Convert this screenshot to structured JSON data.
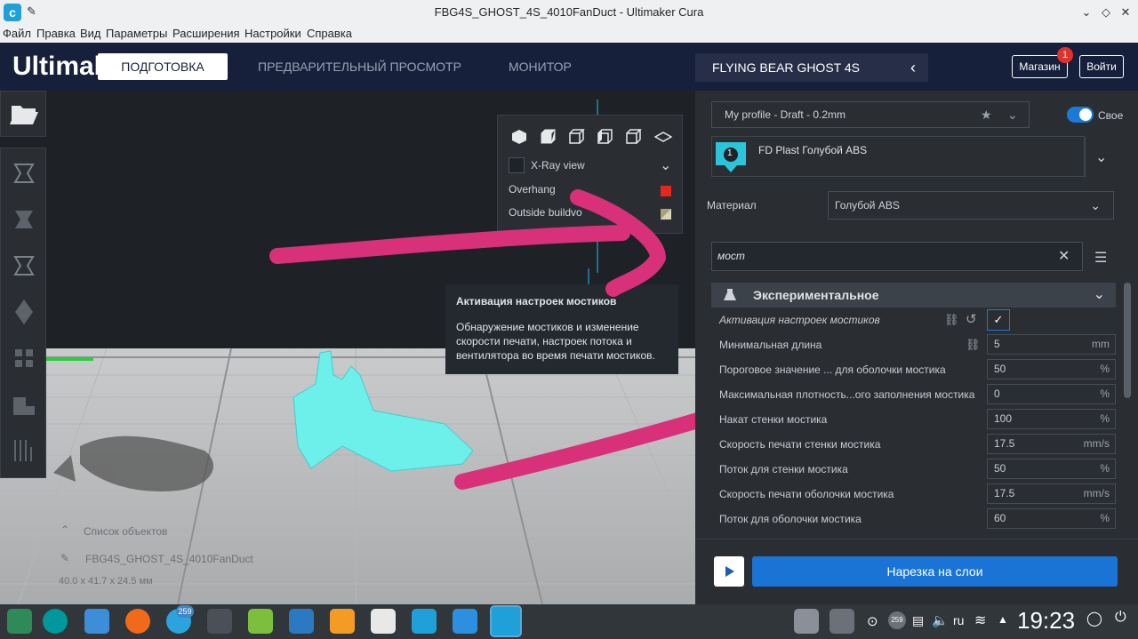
{
  "window": {
    "title": "FBG4S_GHOST_4S_4010FanDuct - Ultimaker Cura"
  },
  "menu": [
    "Файл",
    "Правка",
    "Вид",
    "Параметры",
    "Расширения",
    "Настройки",
    "Справка"
  ],
  "header": {
    "logo": "Ultimal",
    "tabs": [
      "ПОДГОТОВКА",
      "ПРЕДВАРИТЕЛЬНЫЙ ПРОСМОТР",
      "МОНИТОР"
    ],
    "printer": "FLYING BEAR GHOST 4S",
    "store_label": "Магазин",
    "store_badge": "1",
    "login_label": "Войти"
  },
  "view_panel": {
    "xray_label": "X-Ray view",
    "overhang_label": "Overhang",
    "outside_label": "Outside buildvo",
    "overhang_color": "#e8261e"
  },
  "tooltip": {
    "title": "Активация настроек мостиков",
    "body": "Обнаружение мостиков и изменение скорости печати, настроек потока и вентилятора во время печати мостиков."
  },
  "objects": {
    "list_label": "Список объектов",
    "object_name": "FBG4S_GHOST_4S_4010FanDuct",
    "dimensions": "40.0 x 41.7 x 24.5 мм"
  },
  "settings_panel": {
    "profile": "My profile - Draft - 0.2mm",
    "custom_label": "Свое",
    "extruder_number": "1",
    "extruder_material": "FD Plast Голубой ABS",
    "material_label": "Материал",
    "material_value": "Голубой ABS",
    "search_value": "мост",
    "category": "Экспериментальное",
    "rows": [
      {
        "label": "Активация настроек мостиков",
        "value": "",
        "unit": ""
      },
      {
        "label": "Минимальная длина",
        "value": "5",
        "unit": "mm"
      },
      {
        "label": "Пороговое значение ... для оболочки мостика",
        "value": "50",
        "unit": "%"
      },
      {
        "label": "Максимальная плотность...ого заполнения мостика",
        "value": "0",
        "unit": "%"
      },
      {
        "label": "Накат стенки мостика",
        "value": "100",
        "unit": "%"
      },
      {
        "label": "Скорость печати стенки мостика",
        "value": "17.5",
        "unit": "mm/s"
      },
      {
        "label": "Поток для стенки мостика",
        "value": "50",
        "unit": "%"
      },
      {
        "label": "Скорость печати оболочки мостика",
        "value": "17.5",
        "unit": "mm/s"
      },
      {
        "label": "Поток для оболочки мостика",
        "value": "60",
        "unit": "%"
      }
    ],
    "slice_label": "Нарезка на слои"
  },
  "taskbar": {
    "badge_count": "259",
    "badge_count_2": "259",
    "language": "ru",
    "clock": "19:23"
  }
}
